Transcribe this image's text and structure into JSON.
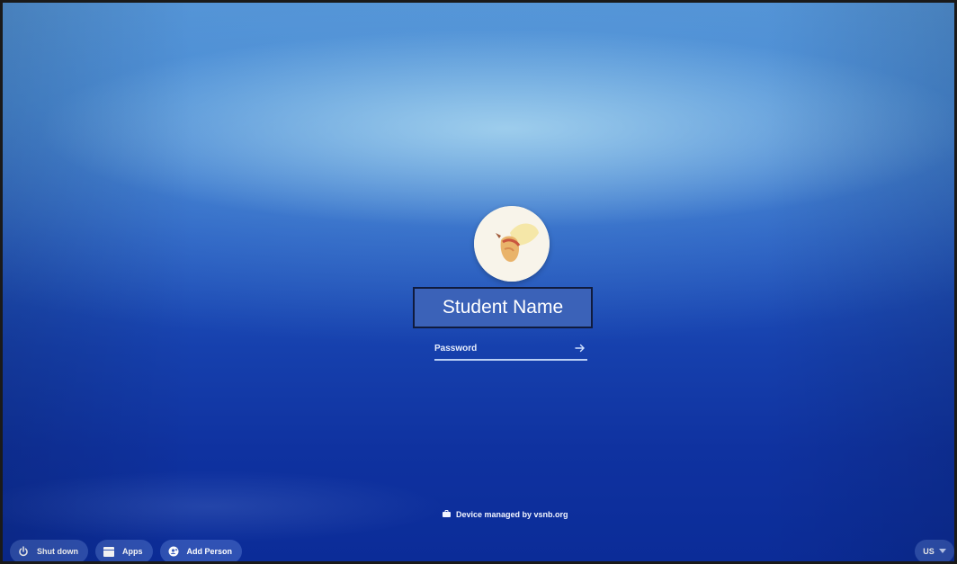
{
  "login": {
    "user_name": "Student Name",
    "password_placeholder": "Password"
  },
  "footer": {
    "managed_text": "Device managed by vsnb.org"
  },
  "shelf": {
    "shutdown_label": "Shut down",
    "apps_label": "Apps",
    "add_person_label": "Add Person",
    "ime_label": "US"
  },
  "icons": {
    "avatar": "user-avatar",
    "submit": "arrow-right-icon",
    "managed": "briefcase-icon",
    "shutdown": "power-icon",
    "apps": "apps-icon",
    "add_person": "add-person-icon",
    "ime": "chevron-down-icon"
  },
  "colors": {
    "background_top": "#4f8fd4",
    "background_bottom": "#0b2c98",
    "name_box": "#3b62b8",
    "underline": "#b9cff5"
  }
}
